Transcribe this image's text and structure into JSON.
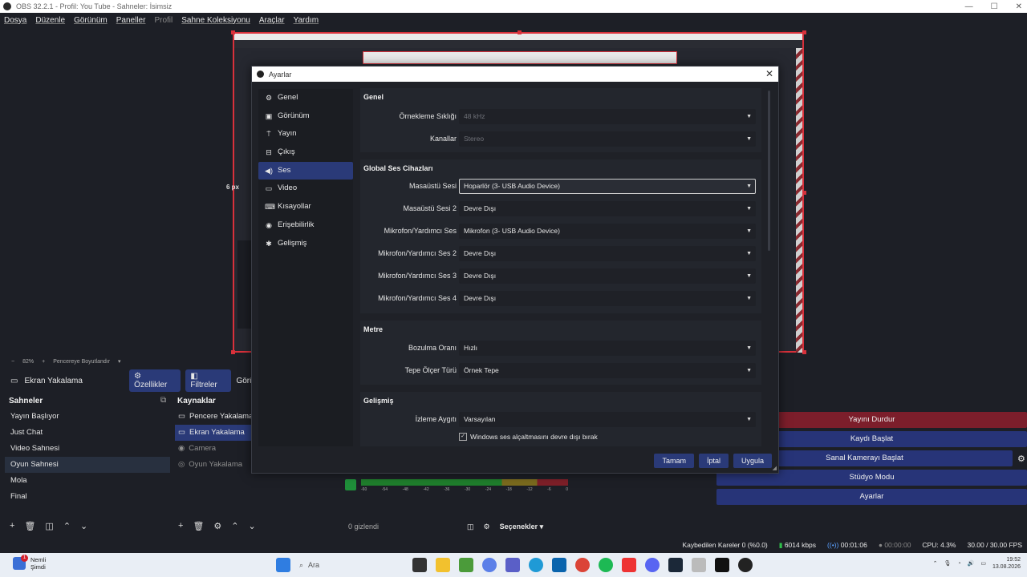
{
  "window": {
    "title": "OBS 32.2.1 - Profil: You Tube - Sahneler: İsimsiz"
  },
  "menubar": [
    "Dosya",
    "Düzenle",
    "Görünüm",
    "Paneller",
    "Profil",
    "Sahne Koleksiyonu",
    "Araçlar",
    "Yardım"
  ],
  "preview": {
    "px_label": "6 px",
    "zoom": "82%",
    "zoom_mode": "Pencereye Boyutlandır"
  },
  "source_toolbar": {
    "source_name": "Ekran Yakalama",
    "properties": "Özellikler",
    "filters": "Filtreler",
    "more": "Görür"
  },
  "scenes": {
    "title": "Sahneler",
    "items": [
      {
        "label": "Yayın Başlıyor",
        "active": false
      },
      {
        "label": "Just Chat",
        "active": false
      },
      {
        "label": "Video Sahnesi",
        "active": false
      },
      {
        "label": "Oyun Sahnesi",
        "active": true
      },
      {
        "label": "Mola",
        "active": false
      },
      {
        "label": "Final",
        "active": false
      }
    ]
  },
  "sources": {
    "title": "Kaynaklar",
    "items": [
      {
        "label": "Pencere Yakalama",
        "icon": "window-icon",
        "state": "normal"
      },
      {
        "label": "Ekran Yakalama",
        "icon": "monitor-icon",
        "state": "active"
      },
      {
        "label": "Camera",
        "icon": "camera-icon",
        "state": "dim"
      },
      {
        "label": "Oyun Yakalama",
        "icon": "gamepad-icon",
        "state": "dim"
      }
    ]
  },
  "mixer": {
    "scale": [
      "-60",
      "-54",
      "-48",
      "-42",
      "-36",
      "-30",
      "-24",
      "-18",
      "-12",
      "-6",
      "0"
    ],
    "hidden_count": "0 gizlendi",
    "options": "Seçenekler"
  },
  "controls": {
    "stop_stream": "Yayını Durdur",
    "start_record": "Kaydı Başlat",
    "start_virtualcam": "Sanal Kamerayı Başlat",
    "studio_mode": "Stüdyo Modu",
    "settings": "Ayarlar"
  },
  "statusbar": {
    "dropped_frames": "Kaybedilen Kareler 0 (%0.0)",
    "bitrate": "6014 kbps",
    "stream_time": "00:01:06",
    "record_time": "00:00:00",
    "cpu": "CPU: 4.3%",
    "fps": "30.00 / 30.00 FPS"
  },
  "taskbar": {
    "weather_title": "Nemli",
    "weather_sub": "Şimdi",
    "notification_count": "1",
    "search_placeholder": "Ara",
    "time": "19:52",
    "date": "13.08.2026"
  },
  "settings_dialog": {
    "title": "Ayarlar",
    "nav": [
      {
        "label": "Genel",
        "icon": "gear-icon",
        "active": false
      },
      {
        "label": "Görünüm",
        "icon": "appearance-icon",
        "active": false
      },
      {
        "label": "Yayın",
        "icon": "broadcast-icon",
        "active": false
      },
      {
        "label": "Çıkış",
        "icon": "output-icon",
        "active": false
      },
      {
        "label": "Ses",
        "icon": "speaker-icon",
        "active": true
      },
      {
        "label": "Video",
        "icon": "video-icon",
        "active": false
      },
      {
        "label": "Kısayollar",
        "icon": "keyboard-icon",
        "active": false
      },
      {
        "label": "Erişebilirlik",
        "icon": "accessibility-icon",
        "active": false
      },
      {
        "label": "Gelişmiş",
        "icon": "wrench-icon",
        "active": false
      }
    ],
    "general": {
      "title": "Genel",
      "sample_rate_label": "Örnekleme Sıklığı",
      "sample_rate_value": "48 kHz",
      "channels_label": "Kanallar",
      "channels_value": "Stereo"
    },
    "global_devices": {
      "title": "Global Ses Cihazları",
      "rows": [
        {
          "label": "Masaüstü Sesi",
          "value": "Hoparlör (3- USB Audio Device)"
        },
        {
          "label": "Masaüstü Sesi 2",
          "value": "Devre Dışı"
        },
        {
          "label": "Mikrofon/Yardımcı Ses",
          "value": "Mikrofon (3- USB Audio Device)"
        },
        {
          "label": "Mikrofon/Yardımcı Ses 2",
          "value": "Devre Dışı"
        },
        {
          "label": "Mikrofon/Yardımcı Ses 3",
          "value": "Devre Dışı"
        },
        {
          "label": "Mikrofon/Yardımcı Ses 4",
          "value": "Devre Dışı"
        }
      ]
    },
    "meters": {
      "title": "Metre",
      "decay_label": "Bozulma Oranı",
      "decay_value": "Hızlı",
      "peak_label": "Tepe Ölçer Türü",
      "peak_value": "Örnek Tepe"
    },
    "advanced": {
      "title": "Gelişmiş",
      "monitor_label": "İzleme Aygıtı",
      "monitor_value": "Varsayılan",
      "ducking_label": "Windows ses alçaltmasını devre dışı bırak"
    },
    "buttons": {
      "ok": "Tamam",
      "cancel": "İptal",
      "apply": "Uygula"
    }
  }
}
